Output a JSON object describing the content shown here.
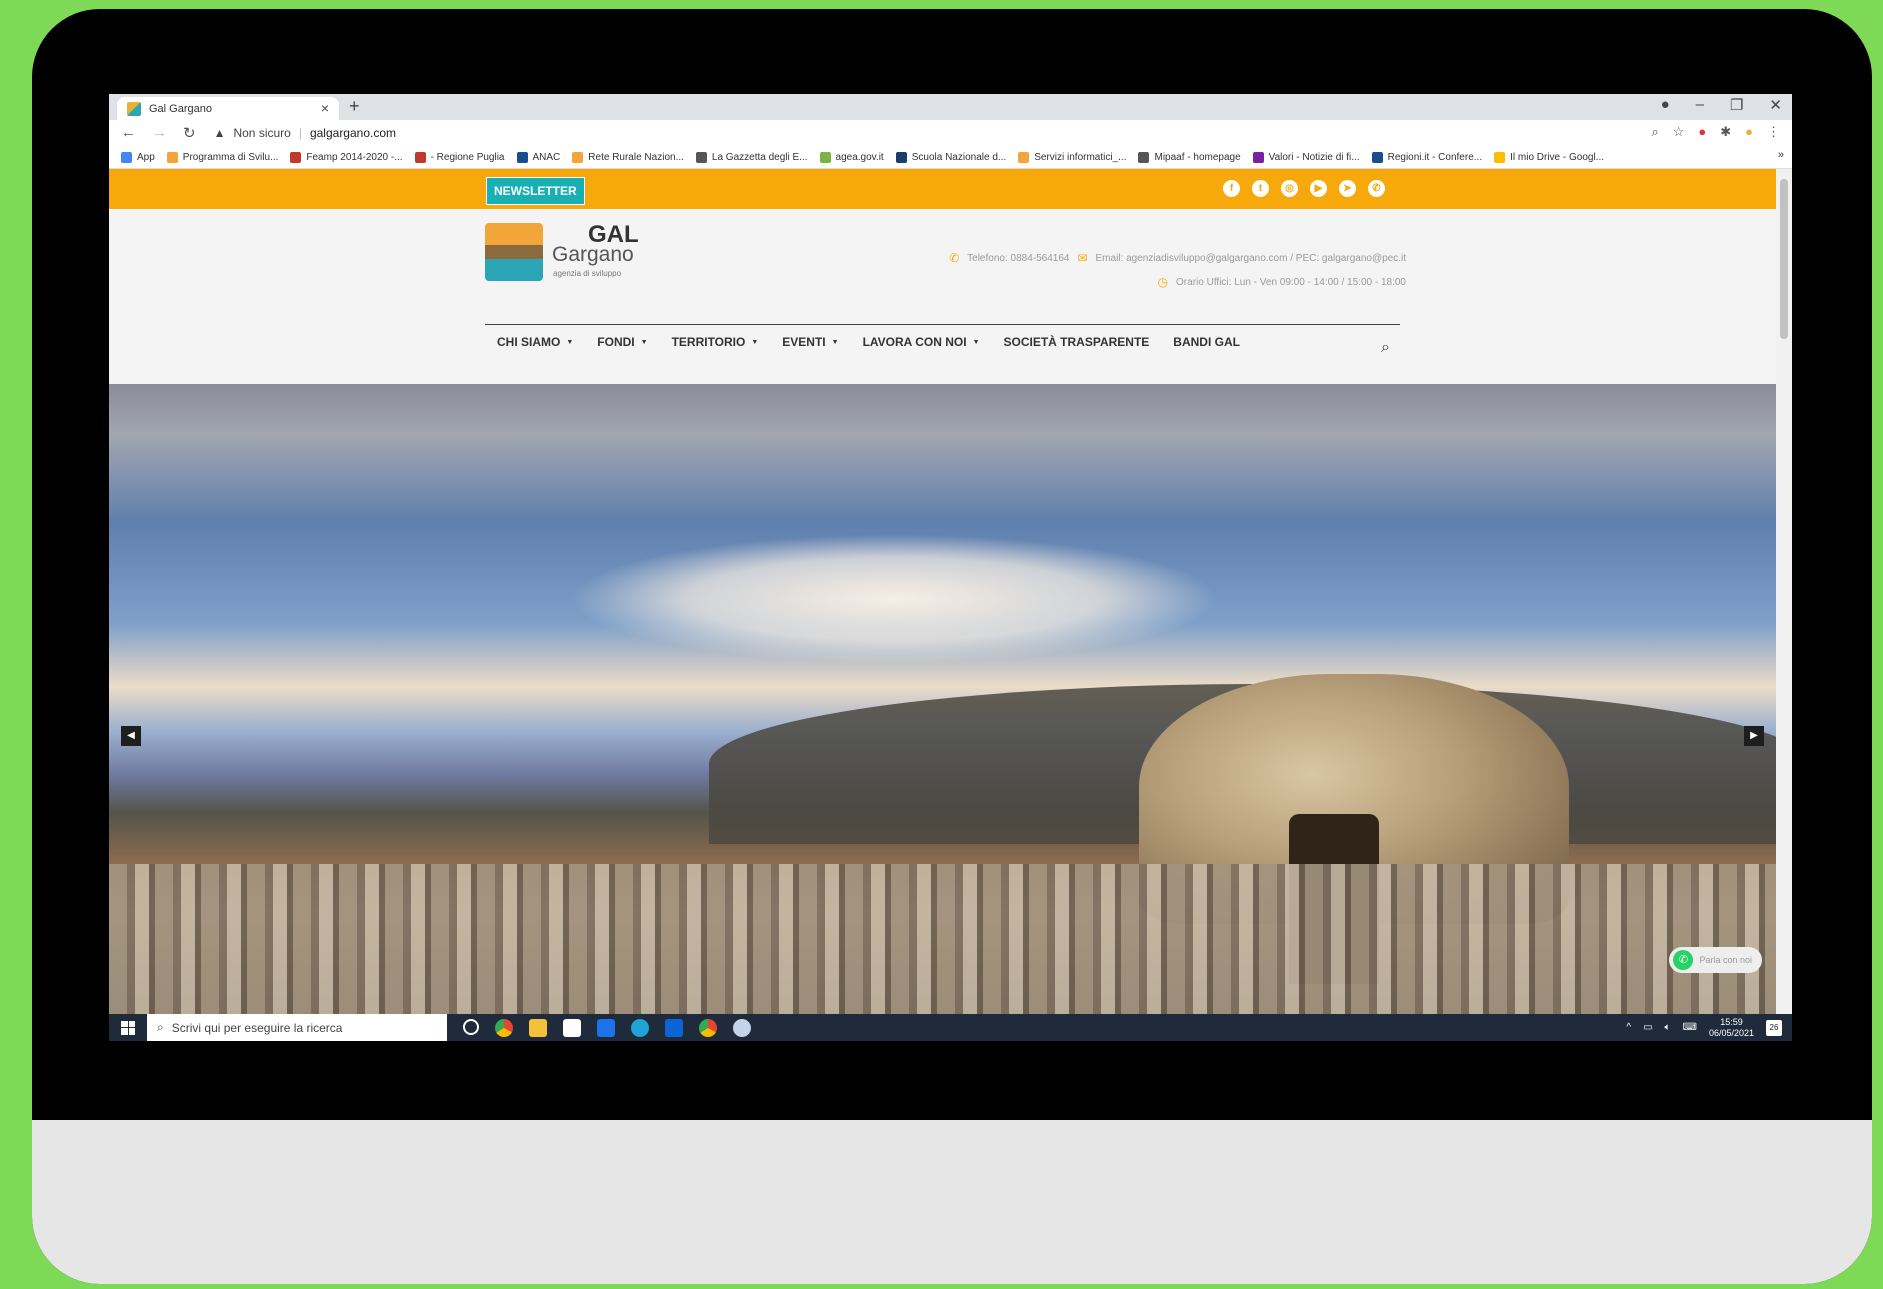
{
  "browser": {
    "tab_title": "Gal Gargano",
    "tab_close": "×",
    "new_tab": "+",
    "security_label": "Non sicuro",
    "url": "galgargano.com",
    "window_controls": [
      "–",
      "❐",
      "✕"
    ]
  },
  "bookmarks": [
    {
      "label": "App",
      "color": "#4285f4"
    },
    {
      "label": "Programma di Svilu...",
      "color": "#f2a63a"
    },
    {
      "label": "Feamp 2014-2020 -...",
      "color": "#c0392b"
    },
    {
      "label": "- Regione Puglia",
      "color": "#c0392b"
    },
    {
      "label": "ANAC",
      "color": "#1a4d8f"
    },
    {
      "label": "Rete Rurale Nazion...",
      "color": "#f2a63a"
    },
    {
      "label": "La Gazzetta degli E...",
      "color": "#555555"
    },
    {
      "label": "agea.gov.it",
      "color": "#7cb342"
    },
    {
      "label": "Scuola Nazionale d...",
      "color": "#1a3d6d"
    },
    {
      "label": "Servizi informatici_...",
      "color": "#f2a63a"
    },
    {
      "label": "Mipaaf - homepage",
      "color": "#555555"
    },
    {
      "label": "Valori - Notizie di fi...",
      "color": "#7b1fa2"
    },
    {
      "label": "Regioni.it - Confere...",
      "color": "#1a4d8f"
    },
    {
      "label": "Il mio Drive - Googl...",
      "color": "#fbbc04"
    }
  ],
  "bookmarks_more": "»",
  "site": {
    "newsletter": "NEWSLETTER",
    "social": [
      "f",
      "t",
      "◎",
      "▶",
      "➤",
      "✆"
    ],
    "logo": {
      "gal": "GAL",
      "name": "Gargano",
      "tagline": "agenzia di sviluppo"
    },
    "phone": "Telefono: 0884-564164",
    "email": "Email: agenziadisviluppo@galgargano.com / PEC: galgargano@pec.it",
    "hours": "Orario Uffici: Lun - Ven 09:00 - 14:00 / 15:00 - 18:00",
    "menu": [
      {
        "label": "CHI SIAMO",
        "dropdown": true
      },
      {
        "label": "FONDI",
        "dropdown": true
      },
      {
        "label": "TERRITORIO",
        "dropdown": true
      },
      {
        "label": "EVENTI",
        "dropdown": true
      },
      {
        "label": "LAVORA CON NOI",
        "dropdown": true
      },
      {
        "label": "SOCIETÀ TRASPARENTE",
        "dropdown": false
      },
      {
        "label": "BANDI GAL",
        "dropdown": false
      }
    ],
    "whatsapp_label": "Parla con noi"
  },
  "taskbar": {
    "search_placeholder": "Scrivi qui per eseguire la ricerca",
    "time": "15:59",
    "date": "06/05/2021",
    "notifications": "26"
  },
  "colors": {
    "accent_orange": "#f7a80a",
    "newsletter_teal": "#19b0b4",
    "outer_green": "#7ed957"
  }
}
